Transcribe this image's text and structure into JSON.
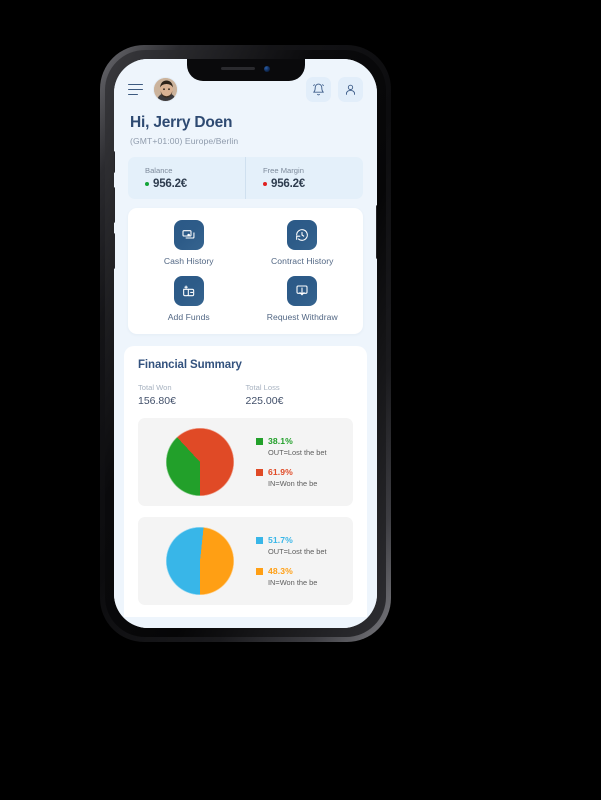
{
  "header": {
    "menu_icon": "hamburger-menu-icon",
    "avatar_icon": "user-avatar-photo",
    "notification_icon": "bell-icon",
    "profile_icon": "person-icon"
  },
  "greeting": {
    "title": "Hi, Jerry Doen",
    "timezone": "(GMT+01:00) Europe/Berlin"
  },
  "balances": [
    {
      "label": "Balance",
      "value": "956.2€",
      "dot_color": "#13a438"
    },
    {
      "label": "Free Margin",
      "value": "956.2€",
      "dot_color": "#e02020"
    }
  ],
  "actions": [
    {
      "label": "Cash History",
      "icon": "cash-history-icon"
    },
    {
      "label": "Contract History",
      "icon": "contract-history-icon"
    },
    {
      "label": "Add Funds",
      "icon": "add-funds-icon"
    },
    {
      "label": "Request Withdraw",
      "icon": "request-withdraw-icon"
    }
  ],
  "summary": {
    "title": "Financial Summary",
    "totals": [
      {
        "label": "Total Won",
        "value": "156.80€"
      },
      {
        "label": "Total Loss",
        "value": "225.00€"
      }
    ]
  },
  "chart_data": [
    {
      "type": "pie",
      "title": "",
      "categories": [
        "OUT=Lost the bet",
        "IN=Won the be"
      ],
      "values": [
        38.1,
        61.9
      ],
      "labels": [
        "38.1%",
        "61.9%"
      ],
      "colors": [
        "#22a02a",
        "#e04a26"
      ],
      "legend_position": "right"
    },
    {
      "type": "pie",
      "title": "",
      "categories": [
        "OUT=Lost the bet",
        "IN=Won the be"
      ],
      "values": [
        51.7,
        48.3
      ],
      "labels": [
        "51.7%",
        "48.3%"
      ],
      "colors": [
        "#38b6e8",
        "#ff9f14"
      ],
      "legend_position": "right"
    }
  ]
}
